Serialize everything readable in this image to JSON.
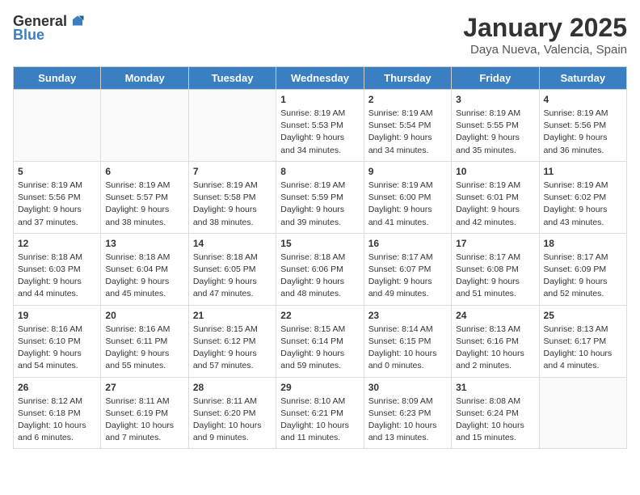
{
  "logo": {
    "general": "General",
    "blue": "Blue"
  },
  "header": {
    "month": "January 2025",
    "location": "Daya Nueva, Valencia, Spain"
  },
  "weekdays": [
    "Sunday",
    "Monday",
    "Tuesday",
    "Wednesday",
    "Thursday",
    "Friday",
    "Saturday"
  ],
  "weeks": [
    [
      {
        "day": "",
        "content": ""
      },
      {
        "day": "",
        "content": ""
      },
      {
        "day": "",
        "content": ""
      },
      {
        "day": "1",
        "content": "Sunrise: 8:19 AM\nSunset: 5:53 PM\nDaylight: 9 hours\nand 34 minutes."
      },
      {
        "day": "2",
        "content": "Sunrise: 8:19 AM\nSunset: 5:54 PM\nDaylight: 9 hours\nand 34 minutes."
      },
      {
        "day": "3",
        "content": "Sunrise: 8:19 AM\nSunset: 5:55 PM\nDaylight: 9 hours\nand 35 minutes."
      },
      {
        "day": "4",
        "content": "Sunrise: 8:19 AM\nSunset: 5:56 PM\nDaylight: 9 hours\nand 36 minutes."
      }
    ],
    [
      {
        "day": "5",
        "content": "Sunrise: 8:19 AM\nSunset: 5:56 PM\nDaylight: 9 hours\nand 37 minutes."
      },
      {
        "day": "6",
        "content": "Sunrise: 8:19 AM\nSunset: 5:57 PM\nDaylight: 9 hours\nand 38 minutes."
      },
      {
        "day": "7",
        "content": "Sunrise: 8:19 AM\nSunset: 5:58 PM\nDaylight: 9 hours\nand 38 minutes."
      },
      {
        "day": "8",
        "content": "Sunrise: 8:19 AM\nSunset: 5:59 PM\nDaylight: 9 hours\nand 39 minutes."
      },
      {
        "day": "9",
        "content": "Sunrise: 8:19 AM\nSunset: 6:00 PM\nDaylight: 9 hours\nand 41 minutes."
      },
      {
        "day": "10",
        "content": "Sunrise: 8:19 AM\nSunset: 6:01 PM\nDaylight: 9 hours\nand 42 minutes."
      },
      {
        "day": "11",
        "content": "Sunrise: 8:19 AM\nSunset: 6:02 PM\nDaylight: 9 hours\nand 43 minutes."
      }
    ],
    [
      {
        "day": "12",
        "content": "Sunrise: 8:18 AM\nSunset: 6:03 PM\nDaylight: 9 hours\nand 44 minutes."
      },
      {
        "day": "13",
        "content": "Sunrise: 8:18 AM\nSunset: 6:04 PM\nDaylight: 9 hours\nand 45 minutes."
      },
      {
        "day": "14",
        "content": "Sunrise: 8:18 AM\nSunset: 6:05 PM\nDaylight: 9 hours\nand 47 minutes."
      },
      {
        "day": "15",
        "content": "Sunrise: 8:18 AM\nSunset: 6:06 PM\nDaylight: 9 hours\nand 48 minutes."
      },
      {
        "day": "16",
        "content": "Sunrise: 8:17 AM\nSunset: 6:07 PM\nDaylight: 9 hours\nand 49 minutes."
      },
      {
        "day": "17",
        "content": "Sunrise: 8:17 AM\nSunset: 6:08 PM\nDaylight: 9 hours\nand 51 minutes."
      },
      {
        "day": "18",
        "content": "Sunrise: 8:17 AM\nSunset: 6:09 PM\nDaylight: 9 hours\nand 52 minutes."
      }
    ],
    [
      {
        "day": "19",
        "content": "Sunrise: 8:16 AM\nSunset: 6:10 PM\nDaylight: 9 hours\nand 54 minutes."
      },
      {
        "day": "20",
        "content": "Sunrise: 8:16 AM\nSunset: 6:11 PM\nDaylight: 9 hours\nand 55 minutes."
      },
      {
        "day": "21",
        "content": "Sunrise: 8:15 AM\nSunset: 6:12 PM\nDaylight: 9 hours\nand 57 minutes."
      },
      {
        "day": "22",
        "content": "Sunrise: 8:15 AM\nSunset: 6:14 PM\nDaylight: 9 hours\nand 59 minutes."
      },
      {
        "day": "23",
        "content": "Sunrise: 8:14 AM\nSunset: 6:15 PM\nDaylight: 10 hours\nand 0 minutes."
      },
      {
        "day": "24",
        "content": "Sunrise: 8:13 AM\nSunset: 6:16 PM\nDaylight: 10 hours\nand 2 minutes."
      },
      {
        "day": "25",
        "content": "Sunrise: 8:13 AM\nSunset: 6:17 PM\nDaylight: 10 hours\nand 4 minutes."
      }
    ],
    [
      {
        "day": "26",
        "content": "Sunrise: 8:12 AM\nSunset: 6:18 PM\nDaylight: 10 hours\nand 6 minutes."
      },
      {
        "day": "27",
        "content": "Sunrise: 8:11 AM\nSunset: 6:19 PM\nDaylight: 10 hours\nand 7 minutes."
      },
      {
        "day": "28",
        "content": "Sunrise: 8:11 AM\nSunset: 6:20 PM\nDaylight: 10 hours\nand 9 minutes."
      },
      {
        "day": "29",
        "content": "Sunrise: 8:10 AM\nSunset: 6:21 PM\nDaylight: 10 hours\nand 11 minutes."
      },
      {
        "day": "30",
        "content": "Sunrise: 8:09 AM\nSunset: 6:23 PM\nDaylight: 10 hours\nand 13 minutes."
      },
      {
        "day": "31",
        "content": "Sunrise: 8:08 AM\nSunset: 6:24 PM\nDaylight: 10 hours\nand 15 minutes."
      },
      {
        "day": "",
        "content": ""
      }
    ]
  ]
}
